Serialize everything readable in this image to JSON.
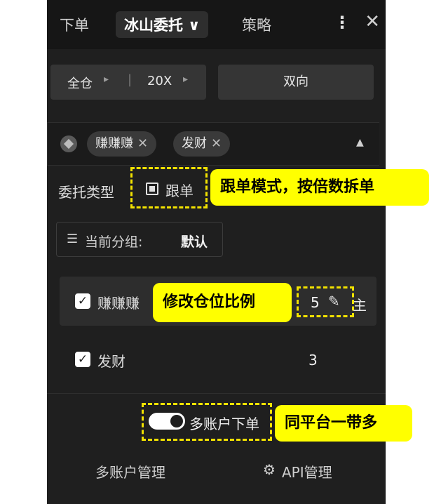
{
  "tabs": [
    {
      "label": "下单"
    },
    {
      "label": "冰山委托 ∨"
    },
    {
      "label": "策略"
    }
  ],
  "top_icons": {
    "menu": "more-vertical-icon",
    "close": "close-icon"
  },
  "margin": {
    "mode": "全仓",
    "leverage": "20X",
    "position_mode": "双向"
  },
  "accounts_chips": [
    "赚赚赚",
    "发财"
  ],
  "order_type": {
    "label": "委托类型",
    "value": "跟单"
  },
  "group": {
    "label": "当前分组:",
    "value": "默认"
  },
  "accounts": [
    {
      "name": "赚赚赚",
      "ratio": "5",
      "trailing": "主"
    },
    {
      "name": "发财",
      "ratio": "3"
    }
  ],
  "multi_account": {
    "label": "多账户下单"
  },
  "footer": {
    "manage": "多账户管理",
    "api": "API管理"
  },
  "annotations": {
    "follow_mode": "跟单模式，按倍数拆单",
    "edit_ratio": "修改仓位比例",
    "same_platform": "同平台一带多"
  },
  "colors": {
    "panel_bg": "#1f1f1f",
    "highlight": "#ffff00",
    "dash": "#f2e200"
  }
}
